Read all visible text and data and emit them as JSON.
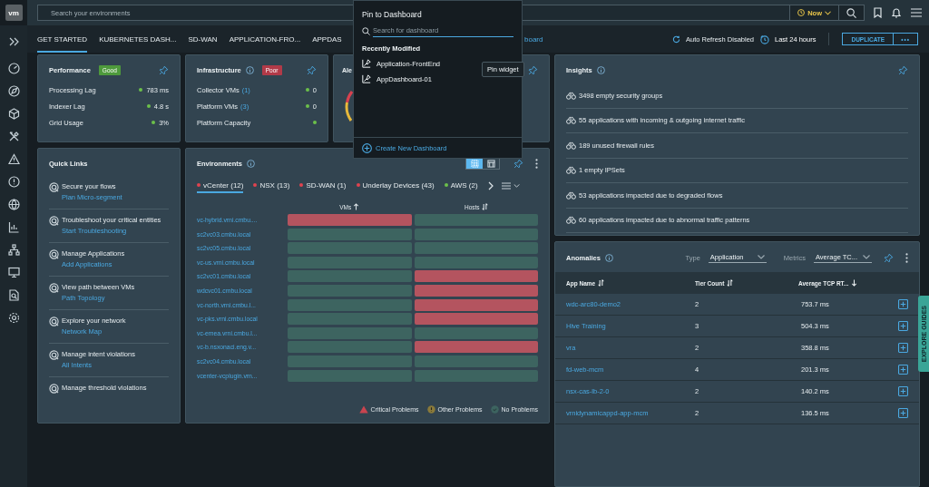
{
  "header": {
    "logo": "vm",
    "search": {
      "placeholder": "Search your environments"
    },
    "time_button": "Now"
  },
  "tabs": [
    {
      "label": "GET STARTED",
      "selected": true
    },
    {
      "label": "KUBERNETES DASH...",
      "selected": false
    },
    {
      "label": "SD-WAN",
      "selected": false
    },
    {
      "label": "APPLICATION-FRO...",
      "selected": false
    },
    {
      "label": "APPDAS",
      "selected": false
    }
  ],
  "tab_link": "board",
  "toolbar": {
    "auto_refresh": "Auto Refresh Disabled",
    "range": "Last 24 hours",
    "duplicate": "DUPLICATE",
    "more": "•••"
  },
  "performance": {
    "title": "Performance",
    "badge": {
      "text": "Good",
      "color": "#4e9a3c"
    },
    "rows": [
      {
        "label": "Processing Lag",
        "value": "783 ms",
        "color": "#6cc04a"
      },
      {
        "label": "Indexer Lag",
        "value": "4.8 s",
        "color": "#6cc04a"
      },
      {
        "label": "Grid Usage",
        "value": "3%",
        "color": "#6cc04a"
      }
    ]
  },
  "infrastructure": {
    "title": "Infrastructure",
    "badge": {
      "text": "Poor",
      "color": "#b23a48"
    },
    "rows": [
      {
        "label": "Collector VMs",
        "count": "(1)",
        "value": "0",
        "color": "#6cc04a"
      },
      {
        "label": "Platform VMs",
        "count": "(3)",
        "value": "0",
        "color": "#6cc04a"
      },
      {
        "label": "Platform Capacity",
        "color": "#6cc04a"
      }
    ]
  },
  "alerts": {
    "title": "Ale"
  },
  "insights": {
    "title": "Insights",
    "items": [
      "3498 empty security groups",
      "55 applications with incoming & outgoing internet traffic",
      "189 unused firewall rules",
      "1 empty IPSets",
      "53 applications impacted due to degraded flows",
      "60 applications impacted due to abnormal traffic patterns"
    ]
  },
  "quick_links": {
    "title": "Quick Links",
    "items": [
      {
        "title": "Secure your flows",
        "link": "Plan Micro-segment"
      },
      {
        "title": "Troubleshoot your critical entities",
        "link": "Start Troubleshooting"
      },
      {
        "title": "Manage Applications",
        "link": "Add Applications"
      },
      {
        "title": "View path between VMs",
        "link": "Path Topology"
      },
      {
        "title": "Explore your network",
        "link": "Network Map"
      },
      {
        "title": "Manage intent violations",
        "link": "All Intents"
      },
      {
        "title": "Manage threshold violations"
      }
    ]
  },
  "environments": {
    "title": "Environments",
    "views": [
      {
        "kind": "grid",
        "selected": true
      },
      {
        "kind": "table",
        "selected": false
      }
    ],
    "tabs": [
      {
        "label": "vCenter (12)",
        "color": "#e0434f",
        "selected": true
      },
      {
        "label": "NSX (13)",
        "color": "#e0434f",
        "selected": false
      },
      {
        "label": "SD-WAN (1)",
        "color": "#e0434f",
        "selected": false
      },
      {
        "label": "Underlay Devices (43)",
        "color": "#e0434f",
        "selected": false
      },
      {
        "label": "AWS (2)",
        "color": "#6cc04a",
        "selected": false
      }
    ],
    "columns": [
      {
        "label": "VMs",
        "sorted": true,
        "ascending": true
      },
      {
        "label": "Hosts",
        "sorted": false
      }
    ],
    "rows": [
      {
        "name": "vc-hybrid.vrni.cmbu....",
        "vms_critical": true,
        "hosts_critical": false
      },
      {
        "name": "sc2vc03.cmbu.local",
        "vms_critical": false,
        "hosts_critical": false
      },
      {
        "name": "sc2vc05.cmbu.local",
        "vms_critical": false,
        "hosts_critical": false
      },
      {
        "name": "vc-us.vrni.cmbu.local",
        "vms_critical": false,
        "hosts_critical": false
      },
      {
        "name": "sc2vc01.cmbu.local",
        "vms_critical": false,
        "hosts_critical": true
      },
      {
        "name": "wdcvc01.cmbu.local",
        "vms_critical": false,
        "hosts_critical": true
      },
      {
        "name": "vc-north.vrni.cmbu.l...",
        "vms_critical": false,
        "hosts_critical": true
      },
      {
        "name": "vc-pks.vrni.cmbu.local",
        "vms_critical": false,
        "hosts_critical": true
      },
      {
        "name": "vc-emea.vrni.cmbu.l...",
        "vms_critical": false,
        "hosts_critical": false
      },
      {
        "name": "vc-b.nsxonaci.eng.v...",
        "vms_critical": false,
        "hosts_critical": true
      },
      {
        "name": "sc2vc04.cmbu.local",
        "vms_critical": false,
        "hosts_critical": false
      },
      {
        "name": "vcenter-vcplugin.vrn...",
        "vms_critical": false,
        "hosts_critical": false
      }
    ],
    "legend": [
      {
        "label": "Critical Problems",
        "kind": "critical"
      },
      {
        "label": "Other Problems",
        "kind": "other"
      },
      {
        "label": "No Problems",
        "kind": "ok"
      }
    ]
  },
  "anomalies": {
    "title": "Anomalies",
    "type_label": "Type",
    "type_value": "Application",
    "metrics_label": "Metrics",
    "metrics_value": "Average TC...",
    "columns": [
      {
        "label": "App Name",
        "sorted": false
      },
      {
        "label": "Tier Count",
        "sorted": false
      },
      {
        "label": "Average TCP RT...",
        "sorted": true,
        "ascending": false
      }
    ],
    "rows": [
      {
        "app": "wdc-arc80-demo2",
        "tiers": "2",
        "rtt": "753.7 ms"
      },
      {
        "app": "Hive Training",
        "tiers": "3",
        "rtt": "504.3 ms"
      },
      {
        "app": "vra",
        "tiers": "2",
        "rtt": "358.8 ms"
      },
      {
        "app": "fd-web-mcm",
        "tiers": "4",
        "rtt": "201.3 ms"
      },
      {
        "app": "nsx-cas-lb-2-0",
        "tiers": "2",
        "rtt": "140.2 ms"
      },
      {
        "app": "vrnidynamicappd-app-mcm",
        "tiers": "2",
        "rtt": "136.5 ms"
      }
    ]
  },
  "pin_popup": {
    "title": "Pin to Dashboard",
    "search_placeholder": "Search for dashboard",
    "section": "Recently Modified",
    "items": [
      "Application-FrontEnd",
      "AppDashboard-01"
    ],
    "create": "Create New Dashboard"
  },
  "tooltip": "Pin widget",
  "explore_guides": "EXPLORE GUIDES"
}
